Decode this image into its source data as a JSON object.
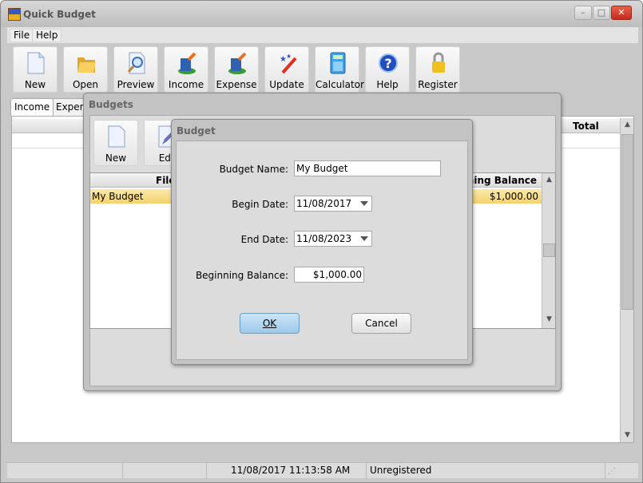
{
  "window": {
    "title": "Quick Budget",
    "controls": [
      "minimize",
      "maximize",
      "close"
    ]
  },
  "menu": [
    {
      "label": "File",
      "mnemonic": "F"
    },
    {
      "label": "Help",
      "mnemonic": "H"
    }
  ],
  "toolbar": [
    {
      "label": "New",
      "icon": "new-document-icon"
    },
    {
      "label": "Open",
      "icon": "folder-open-icon"
    },
    {
      "label": "Preview",
      "icon": "preview-magnifier-icon"
    },
    {
      "label": "Income",
      "icon": "income-building-icon"
    },
    {
      "label": "Expense",
      "icon": "expense-building-icon"
    },
    {
      "label": "Update",
      "icon": "magic-wand-icon"
    },
    {
      "label": "Calculator",
      "icon": "calculator-icon"
    },
    {
      "label": "Help",
      "icon": "help-question-icon"
    },
    {
      "label": "Register",
      "icon": "padlock-icon"
    }
  ],
  "tabs": [
    {
      "label": "Income",
      "active": true
    },
    {
      "label": "Expen"
    }
  ],
  "main_table": {
    "headers": [
      "Total"
    ]
  },
  "status": {
    "datetime": "11/08/2017 11:13:58 AM",
    "registration": "Unregistered"
  },
  "budgets_dialog": {
    "title": "Budgets",
    "buttons": [
      {
        "label": "New"
      },
      {
        "label": "Edi"
      }
    ],
    "headers": [
      "File",
      "ning Balance"
    ],
    "rows": [
      {
        "name": "My Budget",
        "balance": "$1,000.00",
        "selected": true
      }
    ]
  },
  "budget_dialog": {
    "title": "Budget",
    "name_label": "Budget Name:",
    "name_value": "My Budget",
    "begin_label": "Begin Date:",
    "begin_value": "11/08/2017",
    "end_label": "End Date:",
    "end_value": "11/08/2023",
    "balance_label": "Beginning Balance:",
    "balance_value": "$1,000.00",
    "ok": "OK",
    "cancel": "Cancel"
  },
  "colors": {
    "selected_row": "#f7dc85",
    "ok_button": "#a9d1ee",
    "close_button": "#d4402e"
  }
}
